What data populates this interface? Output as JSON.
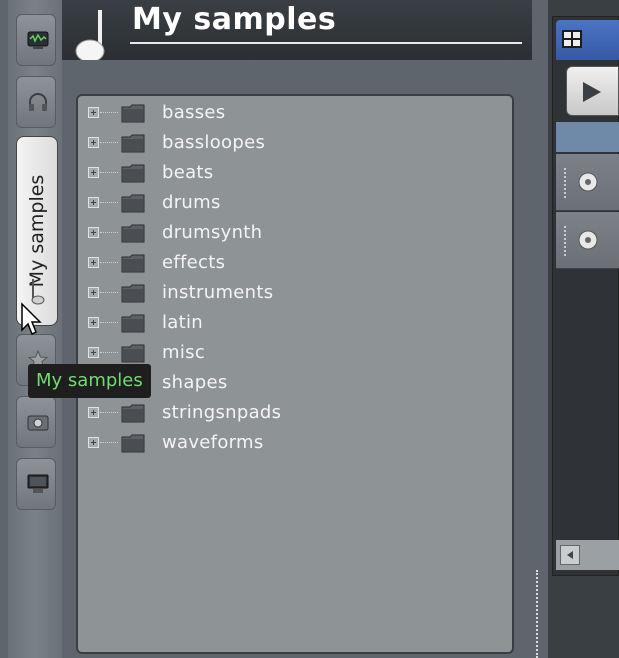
{
  "header": {
    "title": "My samples"
  },
  "sidebar": {
    "active_tab_label": "My samples",
    "tabs": [
      {
        "icon": "monitor-equalizer-icon"
      },
      {
        "icon": "headphones-icon"
      },
      {
        "icon": "note-icon",
        "label": "My samples",
        "active": true
      },
      {
        "icon": "star-icon"
      },
      {
        "icon": "camera-folder-icon"
      },
      {
        "icon": "computer-icon"
      }
    ]
  },
  "tree": {
    "items": [
      {
        "label": "basses"
      },
      {
        "label": "bassloopes"
      },
      {
        "label": "beats"
      },
      {
        "label": "drums"
      },
      {
        "label": "drumsynth"
      },
      {
        "label": "effects"
      },
      {
        "label": "instruments"
      },
      {
        "label": "latin"
      },
      {
        "label": "misc"
      },
      {
        "label": "shapes"
      },
      {
        "label": "stringsnpads"
      },
      {
        "label": "waveforms"
      }
    ]
  },
  "tooltip": {
    "text": "My samples"
  },
  "colors": {
    "tooltip_text": "#6fdc6f",
    "header_bg": "#2b2f33",
    "tree_bg": "#8e9396"
  }
}
